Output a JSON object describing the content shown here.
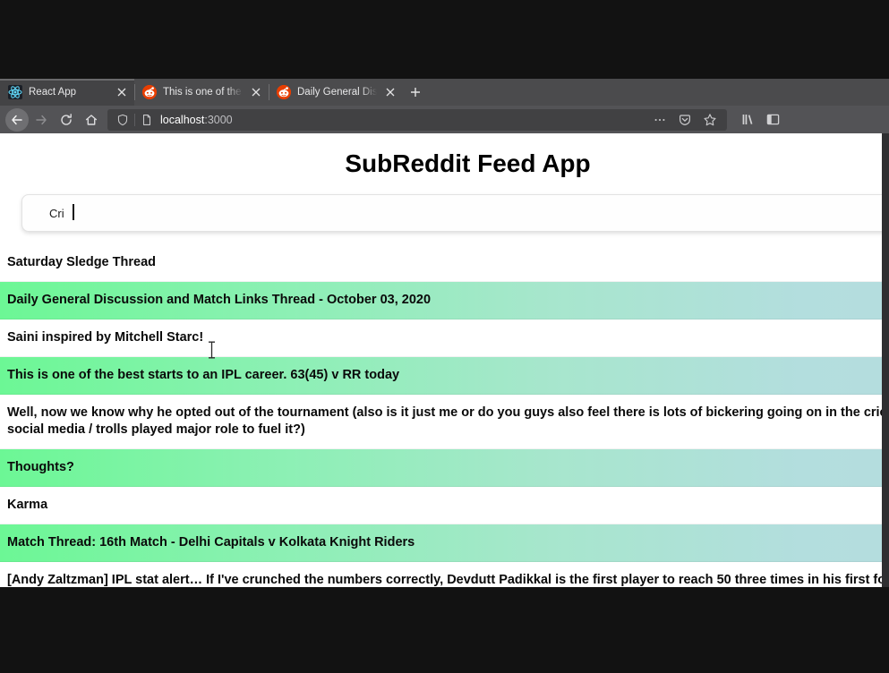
{
  "browser": {
    "tabs": [
      {
        "title": "React App",
        "favicon": "react-icon",
        "active": true
      },
      {
        "title": "This is one of the best sta",
        "favicon": "reddit-icon",
        "active": false
      },
      {
        "title": "Daily General Discussion",
        "favicon": "reddit-icon",
        "active": false
      }
    ],
    "new_tab_label": "+",
    "nav": {
      "back_icon": "back-arrow-icon",
      "forward_icon": "forward-arrow-icon",
      "reload_icon": "reload-icon",
      "home_icon": "home-icon"
    },
    "urlbar": {
      "shield_icon": "shield-icon",
      "page_icon": "page-document-icon",
      "host": "localhost",
      "port": ":3000",
      "meatball_icon": "more-actions-icon",
      "pocket_icon": "pocket-save-icon",
      "star_icon": "bookmark-star-icon"
    },
    "right_toolbar": {
      "library_icon": "library-icon",
      "sidebar_icon": "sidebar-icon"
    }
  },
  "page": {
    "title": "SubReddit Feed App",
    "search": {
      "value": "Cri",
      "placeholder": ""
    },
    "feed": [
      "Saturday Sledge Thread",
      "Daily General Discussion and Match Links Thread - October 03, 2020",
      "Saini inspired by Mitchell Starc!",
      "This is one of the best starts to an IPL career. 63(45) v RR today",
      "Well, now we know why he opted out of the tournament (also is it just me or do you guys also feel there is lots of bickering going on in the cricket fraternity, has social media / trolls played major role to fuel it?)",
      "Thoughts?",
      "Karma",
      "Match Thread: 16th Match - Delhi Capitals v Kolkata Knight Riders",
      "[Andy Zaltzman] IPL  stat alert…  If I've crunched the numbers correctly, Devdutt Padikkal is the first player to reach 50 three times in his first four IPL innings"
    ]
  },
  "colors": {
    "feed_green_start": "#6cf795",
    "feed_green_end": "#b6dbdd",
    "chrome_tabbar": "#4b4b4d",
    "chrome_toolbar": "#535356",
    "desktop": "#121212"
  }
}
